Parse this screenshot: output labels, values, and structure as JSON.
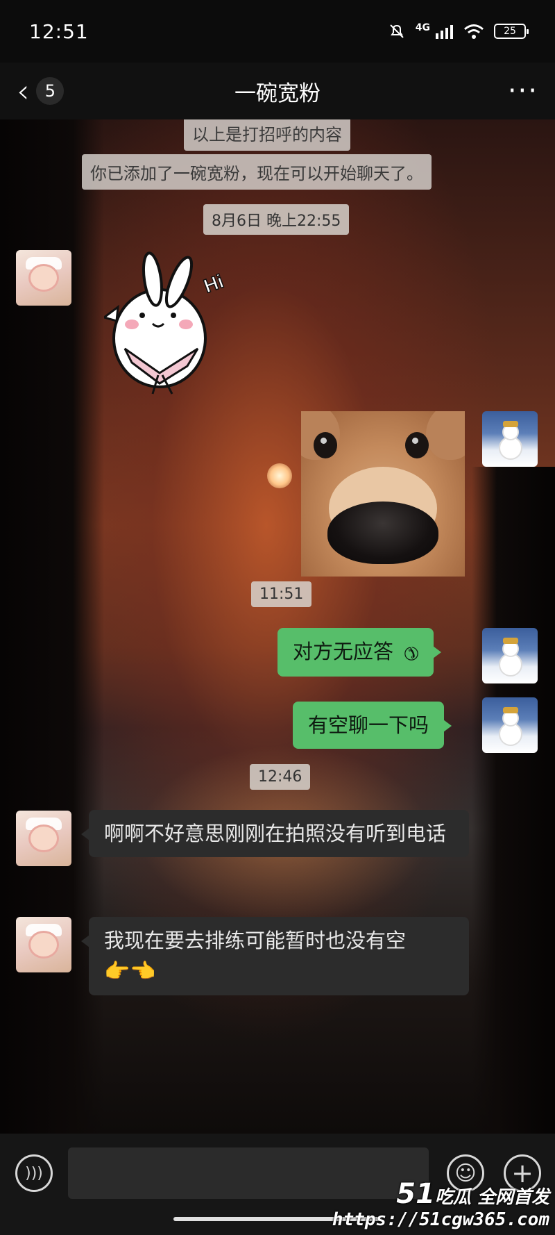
{
  "status_bar": {
    "time": "12:51",
    "network": "4G",
    "battery": "25"
  },
  "header": {
    "back_count": "5",
    "title": "一碗宽粉",
    "more_icon": "more-dots-icon"
  },
  "messages": {
    "system_greeting": "以上是打招呼的内容",
    "system_added": "你已添加了一碗宽粉，现在可以开始聊天了。",
    "time_1": "8月6日 晚上22:55",
    "time_2": "11:51",
    "time_3": "12:46",
    "sent_call": "对方无应答",
    "sent_text": "有空聊一下吗",
    "recv_1": "啊啊不好意思刚刚在拍照没有听到电话",
    "recv_2": "我现在要去排练可能暂时也没有空"
  },
  "stickers": {
    "rabbit_text": "Hi"
  },
  "watermark": {
    "brand_number": "51",
    "brand_text": "吃瓜 全网首发",
    "url": "https://51cgw365.com"
  },
  "colors": {
    "sent_bubble": "#57be6a",
    "received_bubble": "#2c2c2c"
  }
}
